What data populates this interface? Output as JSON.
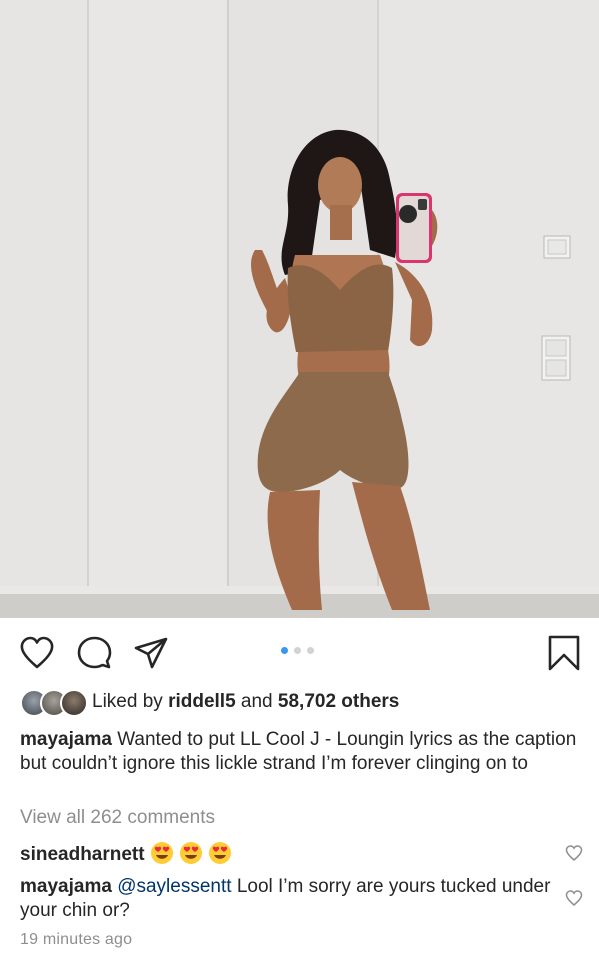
{
  "post": {
    "carousel": {
      "count": 3,
      "active": 1
    },
    "likes": {
      "prefix": "Liked by",
      "user": "riddell5",
      "and": "and",
      "count": "58,702 others"
    },
    "caption": {
      "username": "mayajama",
      "text": "Wanted to put LL Cool J - Loungin lyrics as the caption but couldn’t ignore this lickle strand I’m forever clinging on to"
    },
    "view_all": "View all 262 comments",
    "comments": [
      {
        "username": "sineadharnett",
        "emojis": [
          "heart-eyes",
          "heart-eyes",
          "heart-eyes"
        ]
      },
      {
        "username": "mayajama",
        "mention": "@saylessentt",
        "text": "Lool I’m sorry are yours tucked under your chin or?"
      }
    ],
    "timestamp": "19 minutes ago"
  },
  "icons": {
    "like": "heart-icon",
    "comment": "comment-bubble-icon",
    "share": "paper-plane-icon",
    "save": "bookmark-icon"
  },
  "colors": {
    "text": "#262626",
    "muted": "#8e8e8e",
    "mention": "#003569",
    "active_dot": "#3897f0",
    "inactive_dot": "#d2d2d2"
  }
}
